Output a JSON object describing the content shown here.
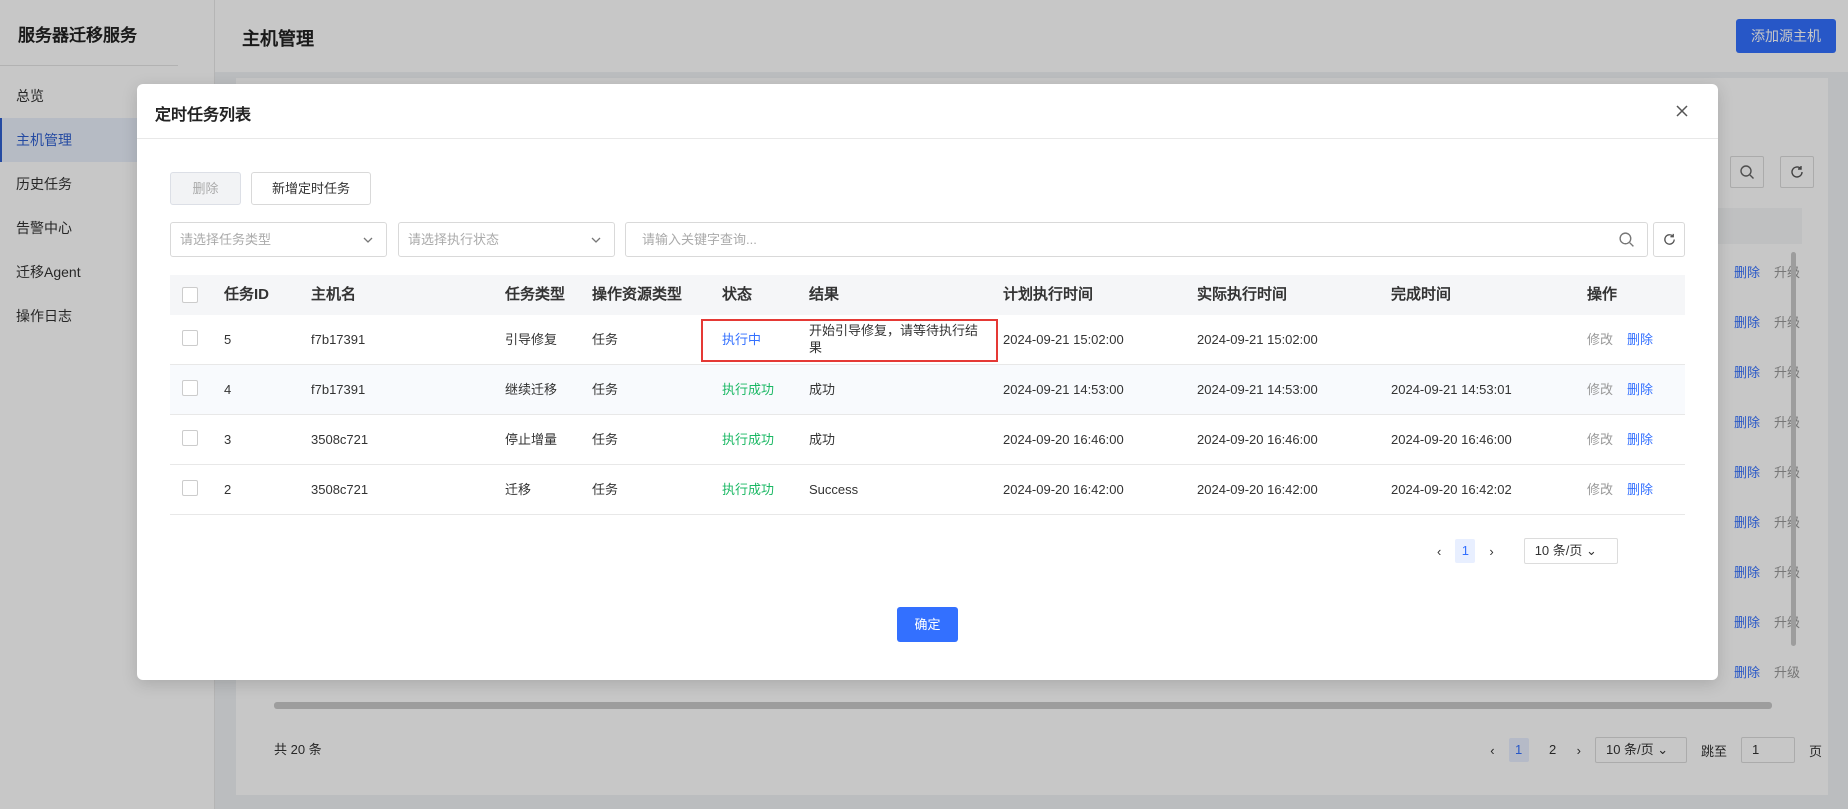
{
  "sidebar": {
    "brand": "服务器迁移服务",
    "items": [
      {
        "label": "总览"
      },
      {
        "label": "主机管理"
      },
      {
        "label": "历史任务"
      },
      {
        "label": "告警中心"
      },
      {
        "label": "迁移Agent"
      },
      {
        "label": "操作日志"
      }
    ]
  },
  "header": {
    "title": "主机管理",
    "add_host_label": "添加源主机"
  },
  "background_table": {
    "row_actions": {
      "delete": "删除",
      "upgrade": "升级"
    },
    "total": "共 20 条",
    "pager": {
      "pages": [
        "1",
        "2"
      ],
      "current": "1",
      "page_size": "10 条/页",
      "jump_label": "跳至",
      "jump_value": "1",
      "page_suffix": "页"
    }
  },
  "modal": {
    "title": "定时任务列表",
    "delete_label": "删除",
    "add_task_label": "新增定时任务",
    "filters": {
      "task_type_placeholder": "请选择任务类型",
      "status_placeholder": "请选择执行状态",
      "keyword_placeholder": "请输入关键字查询..."
    },
    "columns": [
      "任务ID",
      "主机名",
      "任务类型",
      "操作资源类型",
      "状态",
      "结果",
      "计划执行时间",
      "实际执行时间",
      "完成时间",
      "操作"
    ],
    "rows": [
      {
        "id": "5",
        "host": "f7b17391",
        "type": "引导修复",
        "resource": "任务",
        "status": "执行中",
        "status_kind": "running",
        "result": "开始引导修复，请等待执行结果",
        "planned": "2024-09-21 15:02:00",
        "actual": "2024-09-21 15:02:00",
        "finished": "",
        "edit": "修改",
        "del": "删除"
      },
      {
        "id": "4",
        "host": "f7b17391",
        "type": "继续迁移",
        "resource": "任务",
        "status": "执行成功",
        "status_kind": "ok",
        "result": "成功",
        "planned": "2024-09-21 14:53:00",
        "actual": "2024-09-21 14:53:00",
        "finished": "2024-09-21 14:53:01",
        "edit": "修改",
        "del": "删除"
      },
      {
        "id": "3",
        "host": "3508c721",
        "type": "停止增量",
        "resource": "任务",
        "status": "执行成功",
        "status_kind": "ok",
        "result": "成功",
        "planned": "2024-09-20 16:46:00",
        "actual": "2024-09-20 16:46:00",
        "finished": "2024-09-20 16:46:00",
        "edit": "修改",
        "del": "删除"
      },
      {
        "id": "2",
        "host": "3508c721",
        "type": "迁移",
        "resource": "任务",
        "status": "执行成功",
        "status_kind": "ok",
        "result": "Success",
        "planned": "2024-09-20 16:42:00",
        "actual": "2024-09-20 16:42:00",
        "finished": "2024-09-20 16:42:02",
        "edit": "修改",
        "del": "删除"
      }
    ],
    "pager": {
      "current": "1",
      "page_size": "10 条/页"
    },
    "confirm_label": "确定"
  },
  "colors": {
    "primary": "#3370ff",
    "success": "#1bb864",
    "highlight": "#e53935"
  }
}
